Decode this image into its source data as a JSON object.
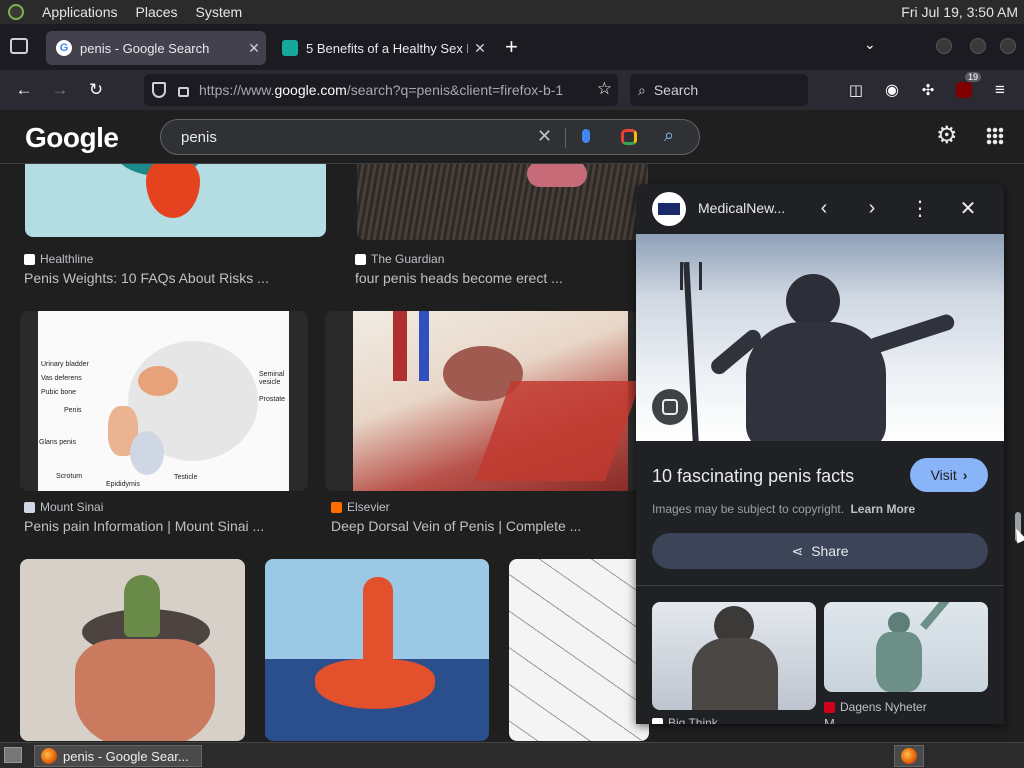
{
  "system": {
    "menus": [
      "Applications",
      "Places",
      "System"
    ],
    "clock": "Fri Jul 19,  3:50 AM"
  },
  "tabs": [
    {
      "title": "penis - Google Search",
      "active": true
    },
    {
      "title": "5 Benefits of a Healthy Sex L",
      "active": false
    }
  ],
  "nav": {
    "url_prefix": "https://www.",
    "url_domain": "google.com",
    "url_rest": "/search?q=penis&client=firefox-b-1",
    "search_placeholder": "Search",
    "extension_badge": "19"
  },
  "google": {
    "logo": "Google",
    "query": "penis"
  },
  "results": [
    {
      "source": "Healthline",
      "caption": "Penis Weights: 10 FAQs About Risks ...",
      "src_color": "#ffffff"
    },
    {
      "source": "The Guardian",
      "caption": "four penis heads become erect ...",
      "src_color": "#ffffff"
    },
    {
      "source": "Mount Sinai",
      "caption": "Penis pain Information | Mount Sinai ...",
      "src_color": "#ffffff"
    },
    {
      "source": "Elsevier",
      "caption": "Deep Dorsal Vein of Penis | Complete ...",
      "src_color": "#ff7a1a"
    }
  ],
  "diagram_labels": {
    "left": [
      "Urinary bladder",
      "Vas deferens",
      "Pubic bone",
      "Penis",
      "Glans penis",
      "Scrotum",
      "Epididymis"
    ],
    "right": [
      "Seminal vesicle",
      "Prostate",
      "Testicle"
    ]
  },
  "panel": {
    "site": "MedicalNew...",
    "title": "10 fascinating penis facts",
    "visit_label": "Visit",
    "copyright": "Images may be subject to copyright.",
    "learn_more": "Learn More",
    "share_label": "Share",
    "related": [
      {
        "source": "Big Think",
        "caption": ""
      },
      {
        "source": "Dagens Nyheter",
        "caption": "M..."
      }
    ]
  },
  "taskbar": {
    "item": "penis - Google Sear..."
  }
}
